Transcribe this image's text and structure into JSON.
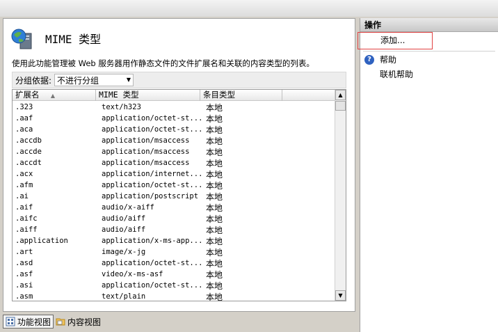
{
  "page": {
    "title": "MIME 类型",
    "description": "使用此功能管理被 Web 服务器用作静态文件的文件扩展名和关联的内容类型的列表。"
  },
  "group": {
    "label": "分组依据:",
    "value": "不进行分组"
  },
  "table": {
    "columns": [
      "扩展名",
      "MIME 类型",
      "条目类型"
    ],
    "rows": [
      {
        "ext": ".323",
        "mime": "text/h323",
        "type": "本地"
      },
      {
        "ext": ".aaf",
        "mime": "application/octet-st...",
        "type": "本地"
      },
      {
        "ext": ".aca",
        "mime": "application/octet-st...",
        "type": "本地"
      },
      {
        "ext": ".accdb",
        "mime": "application/msaccess",
        "type": "本地"
      },
      {
        "ext": ".accde",
        "mime": "application/msaccess",
        "type": "本地"
      },
      {
        "ext": ".accdt",
        "mime": "application/msaccess",
        "type": "本地"
      },
      {
        "ext": ".acx",
        "mime": "application/internet...",
        "type": "本地"
      },
      {
        "ext": ".afm",
        "mime": "application/octet-st...",
        "type": "本地"
      },
      {
        "ext": ".ai",
        "mime": "application/postscript",
        "type": "本地"
      },
      {
        "ext": ".aif",
        "mime": "audio/x-aiff",
        "type": "本地"
      },
      {
        "ext": ".aifc",
        "mime": "audio/aiff",
        "type": "本地"
      },
      {
        "ext": ".aiff",
        "mime": "audio/aiff",
        "type": "本地"
      },
      {
        "ext": ".application",
        "mime": "application/x-ms-app...",
        "type": "本地"
      },
      {
        "ext": ".art",
        "mime": "image/x-jg",
        "type": "本地"
      },
      {
        "ext": ".asd",
        "mime": "application/octet-st...",
        "type": "本地"
      },
      {
        "ext": ".asf",
        "mime": "video/x-ms-asf",
        "type": "本地"
      },
      {
        "ext": ".asi",
        "mime": "application/octet-st...",
        "type": "本地"
      },
      {
        "ext": ".asm",
        "mime": "text/plain",
        "type": "本地"
      }
    ]
  },
  "views": {
    "features": "功能视图",
    "content": "内容视图"
  },
  "actions": {
    "header": "操作",
    "add": "添加...",
    "help": "帮助",
    "online_help": "联机帮助"
  },
  "colors": {
    "accent_blue": "#2f62c0",
    "highlight_red": "#e04040"
  }
}
